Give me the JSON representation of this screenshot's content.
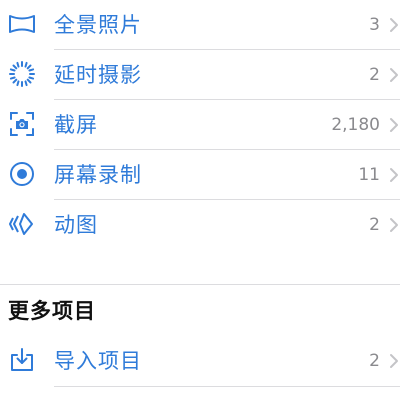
{
  "colors": {
    "accent": "#2f7bd9",
    "count": "#8a8a8e",
    "separator": "#dcdcdf"
  },
  "media_types": [
    {
      "label": "全景照片",
      "count": "3",
      "icon": "panorama-icon"
    },
    {
      "label": "延时摄影",
      "count": "2",
      "icon": "timelapse-icon"
    },
    {
      "label": "截屏",
      "count": "2,180",
      "icon": "screenshot-icon"
    },
    {
      "label": "屏幕录制",
      "count": "11",
      "icon": "screen-recording-icon"
    },
    {
      "label": "动图",
      "count": "2",
      "icon": "animated-icon"
    }
  ],
  "more_items": {
    "title": "更多项目",
    "items": [
      {
        "label": "导入项目",
        "count": "2",
        "icon": "import-icon"
      }
    ]
  }
}
